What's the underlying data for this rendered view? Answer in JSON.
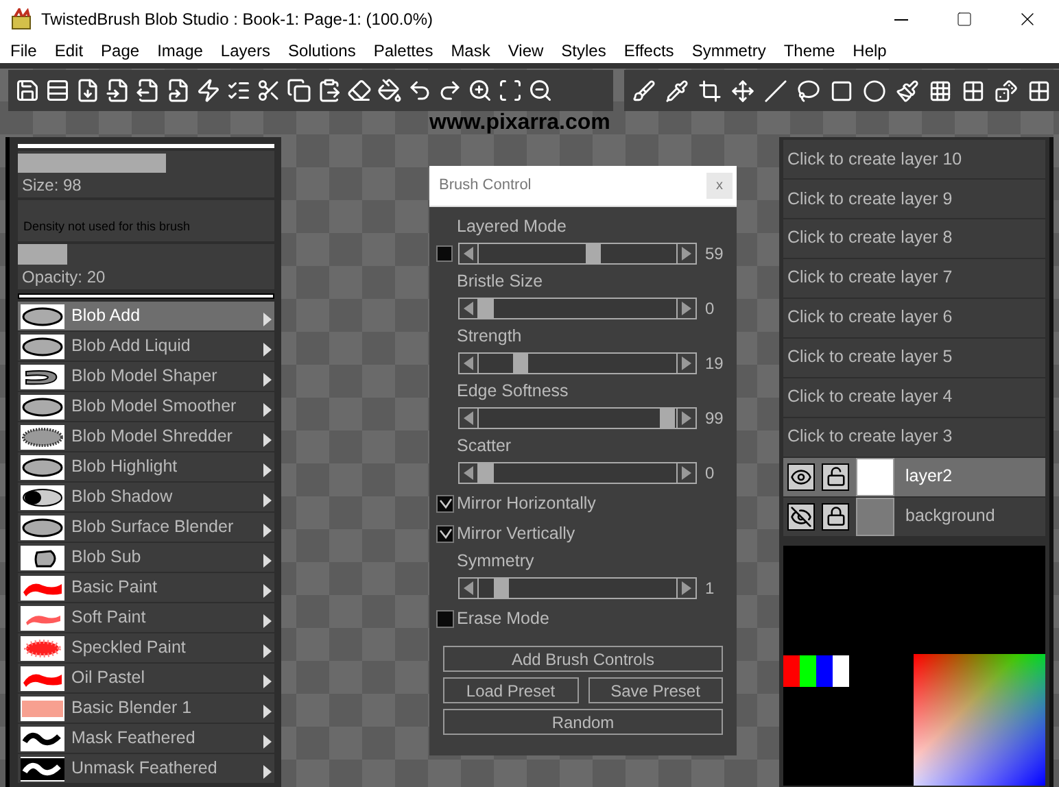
{
  "window": {
    "title": "TwistedBrush Blob Studio : Book-1: Page-1:  (100.0%)"
  },
  "menu": [
    "File",
    "Edit",
    "Page",
    "Image",
    "Layers",
    "Solutions",
    "Palettes",
    "Mask",
    "View",
    "Styles",
    "Effects",
    "Symmetry",
    "Theme",
    "Help"
  ],
  "canvas": {
    "watermark_text": "www.pixarra.com"
  },
  "brush_settings": {
    "size": {
      "label": "Size: 98",
      "level": 0.58
    },
    "density_note": "Density not used for this brush",
    "opacity": {
      "label": "Opacity: 20",
      "level": 0.19
    }
  },
  "brushes": [
    {
      "name": "Blob Add",
      "kind": "blob",
      "selected": true
    },
    {
      "name": "Blob Add Liquid",
      "kind": "blob",
      "selected": false
    },
    {
      "name": "Blob Model Shaper",
      "kind": "hook",
      "selected": false
    },
    {
      "name": "Blob Model Smoother",
      "kind": "blob",
      "selected": false
    },
    {
      "name": "Blob Model Shredder",
      "kind": "speckle_blob",
      "selected": false
    },
    {
      "name": "Blob Highlight",
      "kind": "blob",
      "selected": false
    },
    {
      "name": "Blob Shadow",
      "kind": "shadow",
      "selected": false
    },
    {
      "name": "Blob Surface Blender",
      "kind": "blob",
      "selected": false
    },
    {
      "name": "Blob Sub",
      "kind": "sub",
      "selected": false
    },
    {
      "name": "Basic Paint",
      "kind": "paint",
      "selected": false
    },
    {
      "name": "Soft Paint",
      "kind": "soft_paint",
      "selected": false
    },
    {
      "name": "Speckled Paint",
      "kind": "speckle_paint",
      "selected": false
    },
    {
      "name": "Oil Pastel",
      "kind": "paint",
      "selected": false
    },
    {
      "name": "Basic Blender 1",
      "kind": "blender",
      "selected": false
    },
    {
      "name": "Mask Feathered",
      "kind": "mask",
      "selected": false
    },
    {
      "name": "Unmask Feathered",
      "kind": "unmask",
      "selected": false
    }
  ],
  "brush_control": {
    "title": "Brush Control",
    "close": "x",
    "controls": [
      {
        "kind": "slider",
        "label": "Layered Mode",
        "level": 0.59,
        "reading": "59",
        "checkbox": true,
        "checked": false
      },
      {
        "kind": "slider",
        "label": "Bristle Size",
        "level": 0,
        "reading": "0"
      },
      {
        "kind": "slider",
        "label": "Strength",
        "level": 0.19,
        "reading": "19"
      },
      {
        "kind": "slider",
        "label": "Edge Softness",
        "level": 0.99,
        "reading": "99"
      },
      {
        "kind": "slider",
        "label": "Scatter",
        "level": 0,
        "reading": "0"
      },
      {
        "kind": "check",
        "label": "Mirror Horizontally",
        "checked": true
      },
      {
        "kind": "check",
        "label": "Mirror Vertically",
        "checked": true
      },
      {
        "kind": "slider",
        "label": "Symmetry",
        "level": 0.08,
        "reading": "1"
      },
      {
        "kind": "check",
        "label": "Erase Mode",
        "checked": false
      }
    ],
    "buttons": [
      [
        "Add Brush Controls"
      ],
      [
        "Load Preset",
        "Save Preset"
      ],
      [
        "Random"
      ]
    ]
  },
  "layers": [
    {
      "name": "Click to create layer 10",
      "kind": "empty"
    },
    {
      "name": "Click to create layer 9",
      "kind": "empty"
    },
    {
      "name": "Click to create layer 8",
      "kind": "empty"
    },
    {
      "name": "Click to create layer 7",
      "kind": "empty"
    },
    {
      "name": "Click to create layer 6",
      "kind": "empty"
    },
    {
      "name": "Click to create layer 5",
      "kind": "empty"
    },
    {
      "name": "Click to create layer 4",
      "kind": "empty"
    },
    {
      "name": "Click to create layer 3",
      "kind": "empty"
    },
    {
      "name": "layer2",
      "kind": "layer",
      "selected": true,
      "visible": true,
      "locked": false,
      "color": "#ffffff"
    },
    {
      "name": "background",
      "kind": "layer",
      "selected": false,
      "visible": false,
      "locked": true,
      "color": "#7a7a7a"
    }
  ],
  "swatches": [
    {
      "color": "#ff0000"
    },
    {
      "color": "#00ff00"
    },
    {
      "color": "#0000ff"
    },
    {
      "color": "#ffffff"
    }
  ]
}
